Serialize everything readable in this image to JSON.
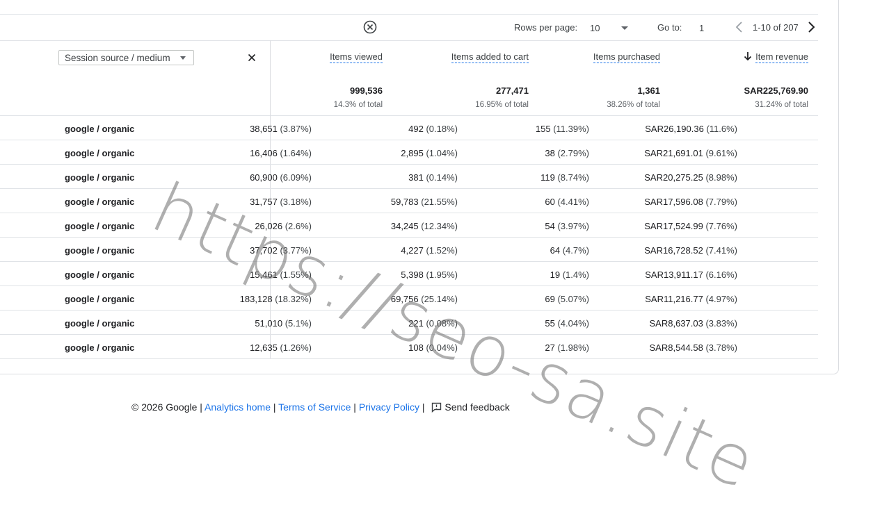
{
  "toolbar": {
    "rows_per_page_label": "Rows per page:",
    "rows_per_page_value": "10",
    "goto_label": "Go to:",
    "goto_value": "1",
    "range_text": "1-10 of 207"
  },
  "dimension": {
    "selector_label": "Session source / medium"
  },
  "metrics": [
    {
      "label": "Items viewed",
      "total": "999,536",
      "pct_of_total": "14.3% of total"
    },
    {
      "label": "Items added to cart",
      "total": "277,471",
      "pct_of_total": "16.95% of total"
    },
    {
      "label": "Items purchased",
      "total": "1,361",
      "pct_of_total": "38.26% of total"
    },
    {
      "label": "Item revenue",
      "total": "SAR225,769.90",
      "pct_of_total": "31.24% of total",
      "sorted": "descending"
    }
  ],
  "rows": [
    {
      "dim": "google / organic",
      "viewed": "38,651",
      "viewed_pct": "(3.87%)",
      "cart": "492",
      "cart_pct": "(0.18%)",
      "purchased": "155",
      "purchased_pct": "(11.39%)",
      "revenue": "SAR26,190.36",
      "revenue_pct": "(11.6%)"
    },
    {
      "dim": "google / organic",
      "viewed": "16,406",
      "viewed_pct": "(1.64%)",
      "cart": "2,895",
      "cart_pct": "(1.04%)",
      "purchased": "38",
      "purchased_pct": "(2.79%)",
      "revenue": "SAR21,691.01",
      "revenue_pct": "(9.61%)"
    },
    {
      "dim": "google / organic",
      "viewed": "60,900",
      "viewed_pct": "(6.09%)",
      "cart": "381",
      "cart_pct": "(0.14%)",
      "purchased": "119",
      "purchased_pct": "(8.74%)",
      "revenue": "SAR20,275.25",
      "revenue_pct": "(8.98%)"
    },
    {
      "dim": "google / organic",
      "viewed": "31,757",
      "viewed_pct": "(3.18%)",
      "cart": "59,783",
      "cart_pct": "(21.55%)",
      "purchased": "60",
      "purchased_pct": "(4.41%)",
      "revenue": "SAR17,596.08",
      "revenue_pct": "(7.79%)"
    },
    {
      "dim": "google / organic",
      "viewed": "26,026",
      "viewed_pct": "(2.6%)",
      "cart": "34,245",
      "cart_pct": "(12.34%)",
      "purchased": "54",
      "purchased_pct": "(3.97%)",
      "revenue": "SAR17,524.99",
      "revenue_pct": "(7.76%)"
    },
    {
      "dim": "google / organic",
      "viewed": "37,702",
      "viewed_pct": "(3.77%)",
      "cart": "4,227",
      "cart_pct": "(1.52%)",
      "purchased": "64",
      "purchased_pct": "(4.7%)",
      "revenue": "SAR16,728.52",
      "revenue_pct": "(7.41%)"
    },
    {
      "dim": "google / organic",
      "viewed": "15,461",
      "viewed_pct": "(1.55%)",
      "cart": "5,398",
      "cart_pct": "(1.95%)",
      "purchased": "19",
      "purchased_pct": "(1.4%)",
      "revenue": "SAR13,911.17",
      "revenue_pct": "(6.16%)"
    },
    {
      "dim": "google / organic",
      "viewed": "183,128",
      "viewed_pct": "(18.32%)",
      "cart": "69,756",
      "cart_pct": "(25.14%)",
      "purchased": "69",
      "purchased_pct": "(5.07%)",
      "revenue": "SAR11,216.77",
      "revenue_pct": "(4.97%)"
    },
    {
      "dim": "google / organic",
      "viewed": "51,010",
      "viewed_pct": "(5.1%)",
      "cart": "221",
      "cart_pct": "(0.08%)",
      "purchased": "55",
      "purchased_pct": "(4.04%)",
      "revenue": "SAR8,637.03",
      "revenue_pct": "(3.83%)"
    },
    {
      "dim": "google / organic",
      "viewed": "12,635",
      "viewed_pct": "(1.26%)",
      "cart": "108",
      "cart_pct": "(0.04%)",
      "purchased": "27",
      "purchased_pct": "(1.98%)",
      "revenue": "SAR8,544.58",
      "revenue_pct": "(3.78%)"
    }
  ],
  "footer": {
    "copyright": "© 2026 Google",
    "links": [
      "Analytics home",
      "Terms of Service",
      "Privacy Policy"
    ],
    "separator": "|",
    "feedback": "Send feedback"
  },
  "watermark": "https://seo-sa.site",
  "icons": {
    "clear": "close-circle-icon",
    "caret": "chevron-down-icon",
    "prev": "chevron-left-icon",
    "next": "chevron-right-icon",
    "remove": "close-icon",
    "sort": "arrow-down-icon",
    "feedback": "feedback-icon"
  },
  "colors": {
    "link": "#1a73e8",
    "text": "#202124",
    "border": "#dadce0"
  }
}
